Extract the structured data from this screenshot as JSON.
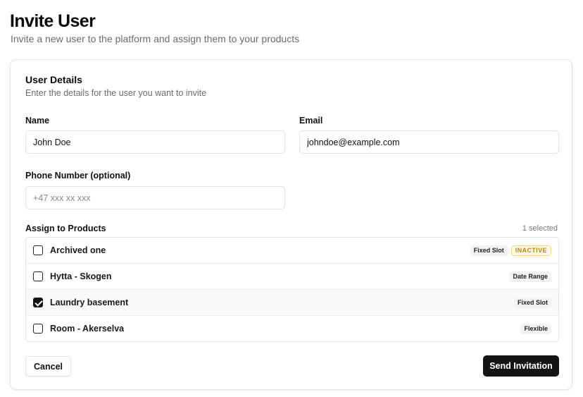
{
  "header": {
    "title": "Invite User",
    "subtitle": "Invite a new user to the platform and assign them to your products"
  },
  "card": {
    "title": "User Details",
    "description": "Enter the details for the user you want to invite"
  },
  "form": {
    "name_label": "Name",
    "name_value": "John Doe",
    "email_label": "Email",
    "email_value": "johndoe@example.com",
    "phone_label": "Phone Number (optional)",
    "phone_placeholder": "+47 xxx xx xxx",
    "phone_value": ""
  },
  "products": {
    "label": "Assign to Products",
    "selected_count": "1 selected",
    "items": [
      {
        "name": "Archived one",
        "checked": false,
        "tags": [
          "Fixed Slot",
          "INACTIVE"
        ]
      },
      {
        "name": "Hytta - Skogen",
        "checked": false,
        "tags": [
          "Date Range"
        ]
      },
      {
        "name": "Laundry basement",
        "checked": true,
        "tags": [
          "Fixed Slot"
        ]
      },
      {
        "name": "Room - Akerselva",
        "checked": false,
        "tags": [
          "Flexible"
        ]
      }
    ]
  },
  "actions": {
    "cancel_label": "Cancel",
    "send_label": "Send Invitation"
  },
  "colors": {
    "primary": "#141414",
    "inactive_text": "#b8860b",
    "inactive_border": "#f2d37c",
    "muted_text": "#6b6b6b"
  }
}
